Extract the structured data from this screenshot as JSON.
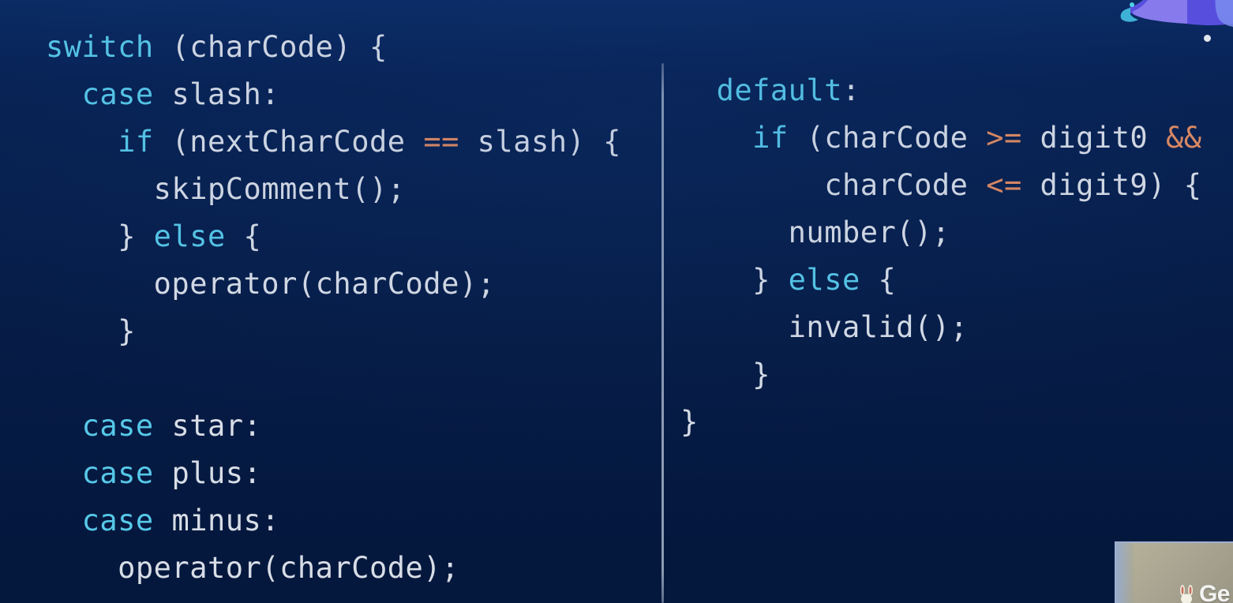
{
  "slide": {
    "title": "switch (charCode)",
    "language": "javascript",
    "background_color": "#072050",
    "divider": {
      "name": "column-divider",
      "color": "#afbcd0"
    },
    "colors": {
      "keyword": "#57c8e8",
      "identifier": "#d8dde6",
      "operator": "#e08a5f",
      "background_top": "#0a2a63",
      "background_bottom": "#04173c"
    }
  },
  "code": {
    "left_column": [
      {
        "indent": 0,
        "tokens": [
          {
            "t": "switch",
            "c": "kw"
          },
          {
            "t": " (charCode) {",
            "c": "txt"
          }
        ]
      },
      {
        "indent": 1,
        "tokens": [
          {
            "t": "case",
            "c": "kw"
          },
          {
            "t": " slash:",
            "c": "txt"
          }
        ]
      },
      {
        "indent": 2,
        "tokens": [
          {
            "t": "if",
            "c": "kw"
          },
          {
            "t": " (nextCharCode ",
            "c": "txt"
          },
          {
            "t": "==",
            "c": "op"
          },
          {
            "t": " slash) {",
            "c": "txt"
          }
        ]
      },
      {
        "indent": 3,
        "tokens": [
          {
            "t": "skipComment();",
            "c": "txt"
          }
        ]
      },
      {
        "indent": 2,
        "tokens": [
          {
            "t": "} ",
            "c": "txt"
          },
          {
            "t": "else",
            "c": "kw"
          },
          {
            "t": " {",
            "c": "txt"
          }
        ]
      },
      {
        "indent": 3,
        "tokens": [
          {
            "t": "operator(charCode);",
            "c": "txt"
          }
        ]
      },
      {
        "indent": 2,
        "tokens": [
          {
            "t": "}",
            "c": "txt"
          }
        ]
      },
      {
        "indent": 0,
        "tokens": []
      },
      {
        "indent": 1,
        "tokens": [
          {
            "t": "case",
            "c": "kw"
          },
          {
            "t": " star:",
            "c": "txt"
          }
        ]
      },
      {
        "indent": 1,
        "tokens": [
          {
            "t": "case",
            "c": "kw"
          },
          {
            "t": " plus:",
            "c": "txt"
          }
        ]
      },
      {
        "indent": 1,
        "tokens": [
          {
            "t": "case",
            "c": "kw"
          },
          {
            "t": " minus:",
            "c": "txt"
          }
        ]
      },
      {
        "indent": 2,
        "tokens": [
          {
            "t": "operator(charCode);",
            "c": "txt"
          }
        ]
      }
    ],
    "right_column": [
      {
        "indent": 1,
        "tokens": [
          {
            "t": "default",
            "c": "kw"
          },
          {
            "t": ":",
            "c": "txt"
          }
        ]
      },
      {
        "indent": 2,
        "tokens": [
          {
            "t": "if",
            "c": "kw"
          },
          {
            "t": " (charCode ",
            "c": "txt"
          },
          {
            "t": ">=",
            "c": "op"
          },
          {
            "t": " digit0 ",
            "c": "txt"
          },
          {
            "t": "&&",
            "c": "op"
          }
        ]
      },
      {
        "indent": 4,
        "tokens": [
          {
            "t": "charCode ",
            "c": "txt"
          },
          {
            "t": "<=",
            "c": "op"
          },
          {
            "t": " digit9) {",
            "c": "txt"
          }
        ]
      },
      {
        "indent": 3,
        "tokens": [
          {
            "t": "number();",
            "c": "txt"
          }
        ]
      },
      {
        "indent": 2,
        "tokens": [
          {
            "t": "} ",
            "c": "txt"
          },
          {
            "t": "else",
            "c": "kw"
          },
          {
            "t": " {",
            "c": "txt"
          }
        ]
      },
      {
        "indent": 3,
        "tokens": [
          {
            "t": "invalid();",
            "c": "txt"
          }
        ]
      },
      {
        "indent": 2,
        "tokens": [
          {
            "t": "}",
            "c": "txt"
          }
        ]
      },
      {
        "indent": 0,
        "tokens": [
          {
            "t": "}",
            "c": "txt"
          }
        ]
      }
    ]
  },
  "overlays": {
    "decoration": {
      "name": "presenter-graphic",
      "colors": [
        "#6b5fe0",
        "#8e7ff0",
        "#3fb6d8"
      ]
    },
    "status_dot": {
      "name": "status-dot",
      "color": "#e7eaf0"
    },
    "picture_in_picture": {
      "name": "presenter-webcam",
      "label": "Ge",
      "logo": "rabbit-logo"
    }
  }
}
